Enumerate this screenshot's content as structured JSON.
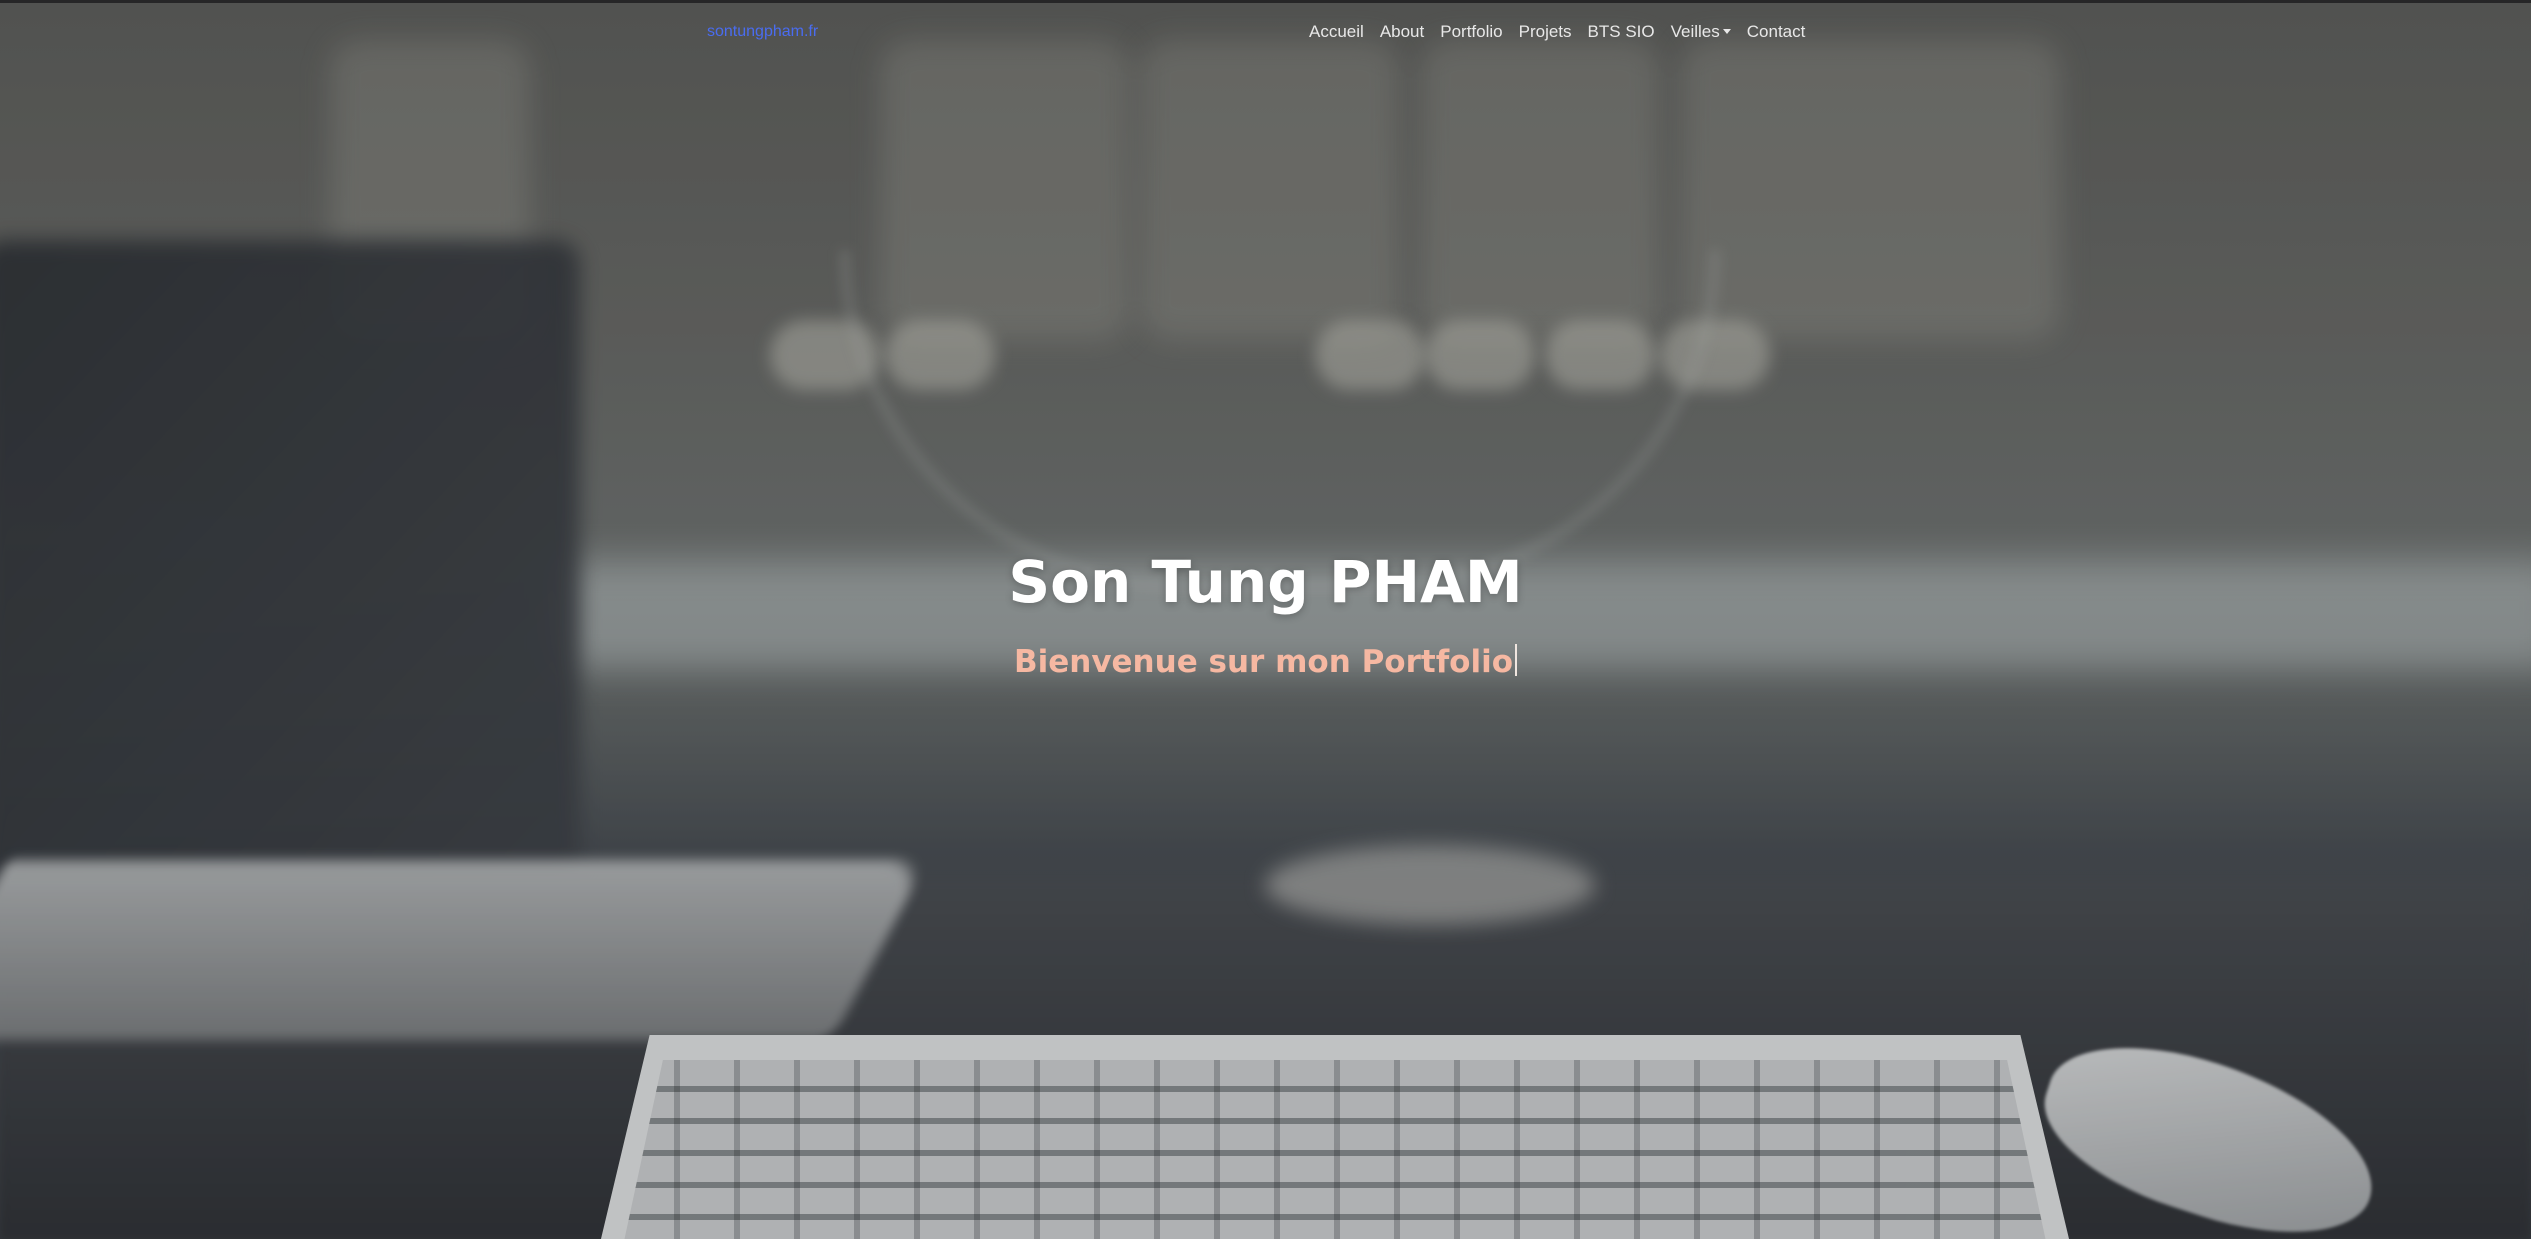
{
  "nav": {
    "brand": "sontungpham.fr",
    "items": [
      {
        "label": "Accueil"
      },
      {
        "label": "About"
      },
      {
        "label": "Portfolio"
      },
      {
        "label": "Projets"
      },
      {
        "label": "BTS SIO"
      },
      {
        "label": "Veilles",
        "dropdown": true
      },
      {
        "label": "Contact"
      }
    ]
  },
  "hero": {
    "title": "Son Tung PHAM",
    "subtitle": "Bienvenue sur mon Portfolio"
  },
  "colors": {
    "brand": "#4a6cf0",
    "subtitle": "#f6b8a2",
    "title": "#ffffff",
    "nav_text": "#e8e8e8"
  }
}
